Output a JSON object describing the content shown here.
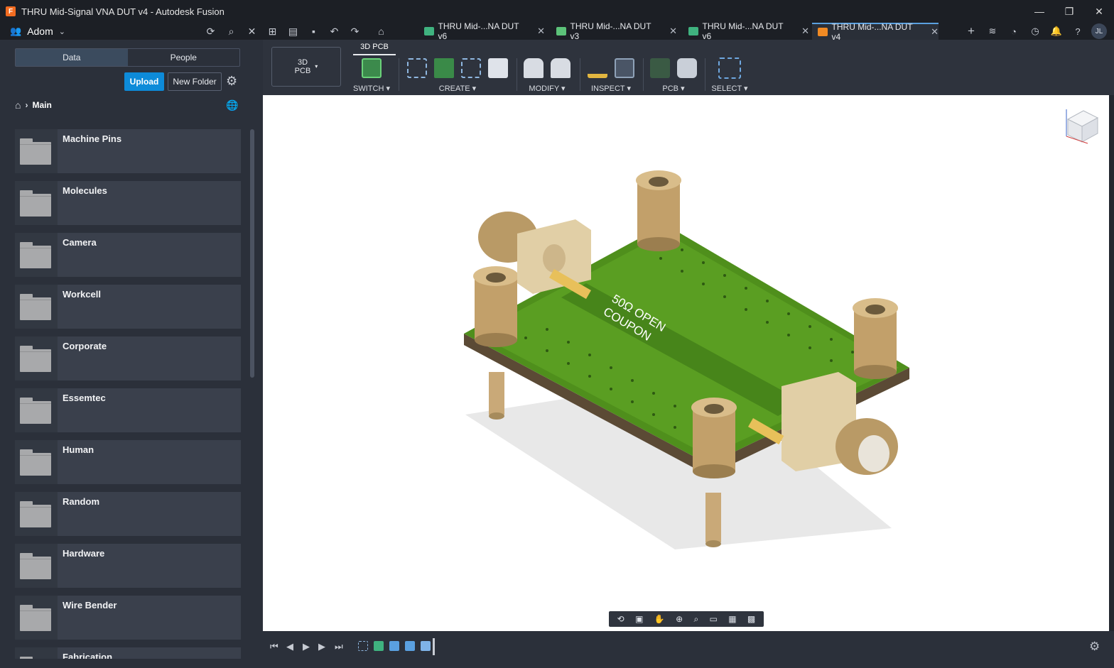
{
  "window": {
    "title": "THRU Mid-Signal VNA DUT v4 - Autodesk Fusion",
    "app_icon": "F",
    "controls": {
      "minimize": "—",
      "restore": "❐",
      "close": "✕"
    }
  },
  "team": {
    "name": "Adom"
  },
  "tabs": [
    {
      "label": "THRU Mid-...NA DUT v6",
      "color": "#3fb27f",
      "active": false
    },
    {
      "label": "THRU Mid-...NA DUT v3",
      "color": "#5cc279",
      "active": false
    },
    {
      "label": "THRU Mid-...NA DUT v6",
      "color": "#3fb27f",
      "active": false
    },
    {
      "label": "THRU Mid-...NA DUT v4",
      "color": "#f08a24",
      "active": true
    }
  ],
  "user_avatar": "JL",
  "data_panel": {
    "segment": {
      "data_label": "Data",
      "people_label": "People"
    },
    "upload_label": "Upload",
    "new_folder_label": "New Folder",
    "breadcrumb": {
      "current": "Main"
    },
    "folders": [
      "Machine Pins",
      "Molecules",
      "Camera",
      "Workcell",
      "Corporate",
      "Essemtec",
      "Human",
      "Random",
      "Hardware",
      "Wire Bender",
      "Fabrication"
    ]
  },
  "toolbar": {
    "workspace_line1": "3D",
    "workspace_line2": "PCB",
    "active_tab": "3D PCB",
    "groups": [
      {
        "label": "SWITCH ▾"
      },
      {
        "label": "CREATE ▾"
      },
      {
        "label": "MODIFY ▾"
      },
      {
        "label": "INSPECT ▾"
      },
      {
        "label": "PCB ▾"
      },
      {
        "label": "SELECT ▾"
      }
    ]
  },
  "pcb_silkscreen": {
    "line1": "50Ω OPEN",
    "line2": "COUPON"
  },
  "colors": {
    "accent": "#0d8bd9",
    "board_green": "#4f8f1c",
    "connector_gold": "#c9a978"
  }
}
